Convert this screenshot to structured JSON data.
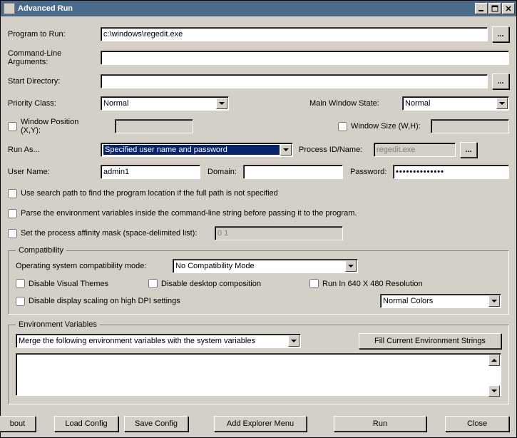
{
  "window": {
    "title": "Advanced Run"
  },
  "labels": {
    "program": "Program to Run:",
    "cmdline": "Command-Line Arguments:",
    "startdir": "Start Directory:",
    "priority": "Priority Class:",
    "mainwinstate": "Main Window State:",
    "winpos": "Window Position (X,Y):",
    "winsize": "Window Size (W,H):",
    "runas": "Run As...",
    "procidname": "Process ID/Name:",
    "username": "User Name:",
    "domain": "Domain:",
    "password": "Password:",
    "searchpath": "Use search path to find the program location if the full path is not specified",
    "parseenv": "Parse the environment variables inside the command-line string before passing it to the program.",
    "affinity": "Set the process affinity mask (space-delimited list):",
    "compat_legend": "Compatibility",
    "oscompat": "Operating system compatibility mode:",
    "disable_themes": "Disable Visual Themes",
    "disable_dwm": "Disable desktop composition",
    "run640": "Run In 640 X 480 Resolution",
    "disable_dpi": "Disable display scaling on high DPI settings",
    "env_legend": "Environment Variables",
    "fill_env_btn": "Fill Current Environment Strings",
    "about": "bout",
    "loadcfg": "Load Config",
    "savecfg": "Save Config",
    "addmenu": "Add Explorer Menu",
    "run": "Run",
    "close": "Close",
    "browse": "..."
  },
  "values": {
    "program": "c:\\windows\\regedit.exe",
    "cmdline": "",
    "startdir": "",
    "priority": "Normal",
    "mainwinstate": "Normal",
    "winpos": "",
    "winsize": "",
    "runas": "Specified user name and password",
    "procid_placeholder": "regedit.exe",
    "username": "admin1",
    "domain": "",
    "password": "••••••••••••••",
    "affinity": "0 1",
    "oscompat": "No Compatibility Mode",
    "colors": "Normal Colors",
    "envmode": "Merge the following environment variables with the system variables",
    "envtext": ""
  },
  "checks": {
    "winpos": false,
    "winsize": false,
    "searchpath": false,
    "parseenv": false,
    "affinity": false,
    "disable_themes": false,
    "disable_dwm": false,
    "run640": false,
    "disable_dpi": false
  }
}
